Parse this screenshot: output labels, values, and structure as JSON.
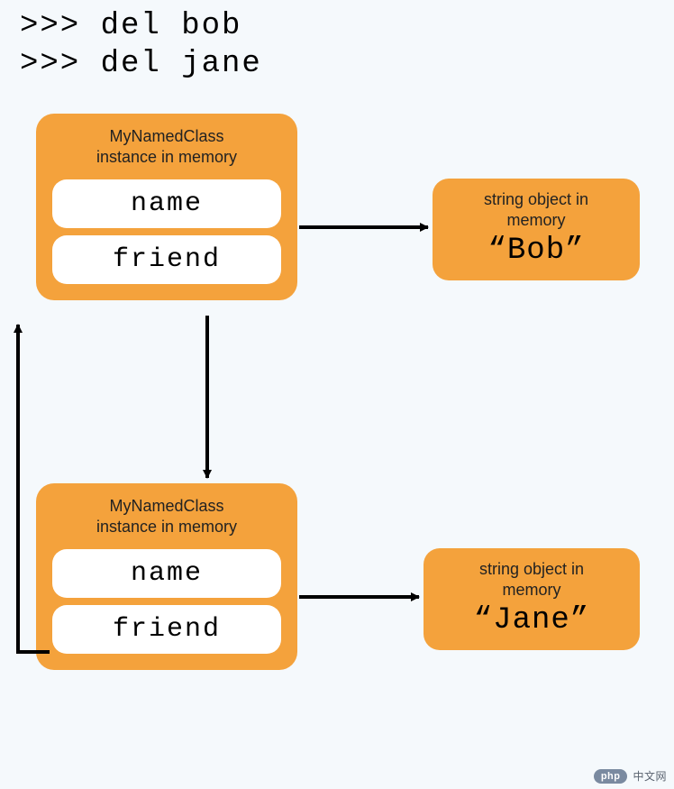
{
  "code": {
    "line1": ">>> del bob",
    "line2": ">>> del jane"
  },
  "box1": {
    "title_line1": "MyNamedClass",
    "title_line2": "instance in memory",
    "attr1": "name",
    "attr2": "friend"
  },
  "box2": {
    "title_line1": "MyNamedClass",
    "title_line2": "instance in memory",
    "attr1": "name",
    "attr2": "friend"
  },
  "str1": {
    "title_line1": "string object in",
    "title_line2": "memory",
    "value": "“Bob”"
  },
  "str2": {
    "title_line1": "string object in",
    "title_line2": "memory",
    "value": "“Jane”"
  },
  "watermark": {
    "badge": "php",
    "text": "中文网"
  },
  "colors": {
    "accent": "#f4a23c",
    "bg": "#f5f9fc"
  }
}
